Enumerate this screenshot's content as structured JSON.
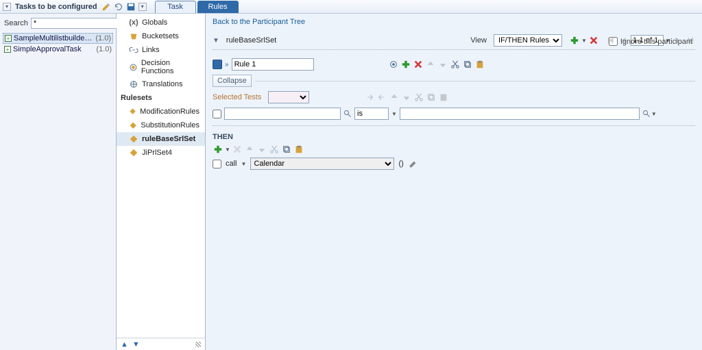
{
  "topbar": {
    "title": "Tasks to be configured"
  },
  "tabs": {
    "task": "Task",
    "rules": "Rules",
    "active": "Rules"
  },
  "search": {
    "label": "Search",
    "value": "*"
  },
  "tasks": {
    "items": [
      {
        "name": "SampleMultilistbuildersTask",
        "ver": "(1.0)",
        "selected": true
      },
      {
        "name": "SimpleApprovalTask",
        "ver": "(1.0)",
        "selected": false
      }
    ]
  },
  "nav": {
    "top": [
      {
        "label": "Globals",
        "icon": "(x)"
      },
      {
        "label": "Bucketsets",
        "icon": "bucket"
      },
      {
        "label": "Links",
        "icon": "link"
      },
      {
        "label": "Decision Functions",
        "icon": "gear"
      },
      {
        "label": "Translations",
        "icon": "globe"
      }
    ],
    "rulesets_label": "Rulesets",
    "rulesets": [
      {
        "label": "ModificationRules"
      },
      {
        "label": "SubstitutionRules"
      },
      {
        "label": "ruleBaseSrlSet",
        "selected": true
      },
      {
        "label": "JiPrlSet4"
      }
    ]
  },
  "content": {
    "backlink": "Back to the Participant Tree",
    "ignore_label": "Ignore this participant",
    "ruleset_name": "ruleBaseSrlSet",
    "view_label": "View",
    "view_value": "IF/THEN Rules",
    "pager_text": "1-1 of 1",
    "rule_name": "Rule 1",
    "collapse_label": "Collapse",
    "selected_tests_label": "Selected Tests",
    "is_text": "is",
    "then_label": "THEN",
    "then_action": "call",
    "then_target": "Calendar",
    "paren": "()"
  }
}
